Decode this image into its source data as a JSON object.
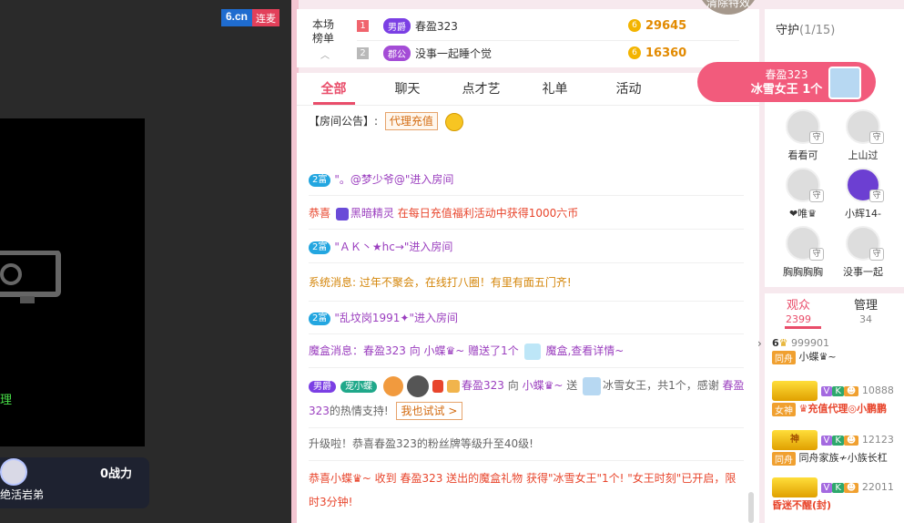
{
  "stage": {
    "watermark_brand": "6.cn",
    "watermark_tag": "连麦",
    "video_side_text": "理",
    "anchor_name": "绝活岩弟",
    "fight_value": "0战力"
  },
  "rank": {
    "label_line1": "本场",
    "label_line2": "榜单",
    "clear_badge": "清除特效",
    "rows": [
      {
        "num": "1",
        "badge": "男爵",
        "badge_color": "#7b3fe4",
        "name": "春盈323",
        "score": "29645"
      },
      {
        "num": "2",
        "badge": "郡公",
        "badge_color": "#a44cd6",
        "name": "没事一起睡个觉",
        "score": "16360"
      }
    ]
  },
  "promo": {
    "name": "春盈323",
    "gift": "冰雪女王 1个"
  },
  "tabs": [
    "全部",
    "聊天",
    "点才艺",
    "礼单",
    "活动"
  ],
  "chat": {
    "notice_label": "【房间公告】:",
    "notice_button": "代理充值",
    "m1_badge": "2富",
    "m1_text": "\"。@梦少爷@\"进入房间",
    "m2_prefix": "恭喜",
    "m2_user": "黑暗精灵",
    "m2_text": "在每日充值福利活动中获得1000六币",
    "m3_badge": "2富",
    "m3_text": "\"ＡＫ丶★hc→\"进入房间",
    "m4_text": "系统消息: 过年不聚会，在线打八圈！有里有面五门齐!",
    "m5_badge": "2富",
    "m5_text": "\"乱坟岗1991✦\"进入房间",
    "m6_text": "魔盒消息：春盈323 向 小蝶♛~ 赠送了1个",
    "m6_link": "魔盒,查看详情~",
    "m7_badge": "男爵",
    "m7_fan": "宠小蝶",
    "m7_user": "春盈323",
    "m7_to": "向",
    "m7_target": "小蝶♛~",
    "m7_send": "送",
    "m7_gift": "冰雪女王，共1个，感谢",
    "m7_user2": "春盈323",
    "m7_thanks": "的热情支持!",
    "m7_try": "我也试试 >",
    "m8_text": "升级啦！恭喜春盈323的粉丝牌等级升至40级!",
    "m9_text": "恭喜小蝶♛~ 收到 春盈323 送出的魔盒礼物 获得\"冰雪女王\"1个! \"女王时刻\"已开启，限时3分钟!"
  },
  "guard": {
    "title": "守护",
    "count": "(1/15)",
    "members": [
      "看看可",
      "上山过",
      "❤唯♛",
      "小辉14-",
      "胸胸胸胸",
      "没事一起"
    ]
  },
  "viewers": {
    "tab1": "观众",
    "tab1_count": "2399",
    "tab2": "管理",
    "tab2_count": "34",
    "list": [
      {
        "prefix": "6",
        "id": "999901",
        "tag": "同舟",
        "name": "小蝶♛~"
      },
      {
        "badge": "",
        "id": "10888",
        "tag": "女神",
        "name": "♛充值代理◎小鹏鹏"
      },
      {
        "badge": "神",
        "id": "12123",
        "tag": "同舟",
        "name": "同舟家族≁小族长杠"
      },
      {
        "badge": "",
        "id": "22011",
        "tag": "",
        "name": "昏迷不醒(封)"
      }
    ]
  }
}
